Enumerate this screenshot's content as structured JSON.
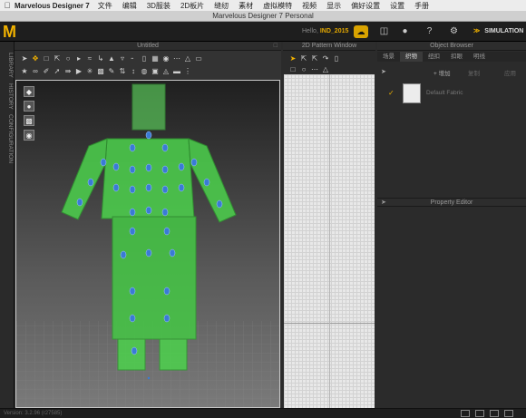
{
  "menubar": {
    "apple": "",
    "app_name": "Marvelous Designer 7",
    "items": [
      "文件",
      "编辑",
      "3D服装",
      "2D板片",
      "缝纫",
      "素材",
      "虚拟模特",
      "视频",
      "显示",
      "偏好设置",
      "设置",
      "手册"
    ]
  },
  "window": {
    "title": "Marvelous Designer 7 Personal"
  },
  "toolbar": {
    "logo": "M",
    "hello_prefix": "Hello,",
    "user": "IND_2015",
    "simulation_label": "SIMULATION"
  },
  "sidebar": {
    "tabs": [
      "LIBRARY",
      "HISTORY",
      "CONFIGURATION"
    ]
  },
  "panes": {
    "three_d_title": "Untitled",
    "two_d_title": "2D Pattern Window",
    "object_browser_title": "Object Browser",
    "property_editor_title": "Property Editor"
  },
  "object_browser": {
    "tabs": [
      "场景",
      "织物",
      "纽扣",
      "扣眼",
      "明线"
    ],
    "active_tab_index": 1,
    "add_label": "+ 增加",
    "copy_label": "复制",
    "apply_label": "应用",
    "fabric_name": "Default Fabric"
  },
  "status": {
    "version": "Version: 3.2.96    (r27585)"
  },
  "colors": {
    "accent": "#f2b200",
    "avatar_green": "#4cd24c",
    "pin_blue": "#3a7bd5"
  }
}
